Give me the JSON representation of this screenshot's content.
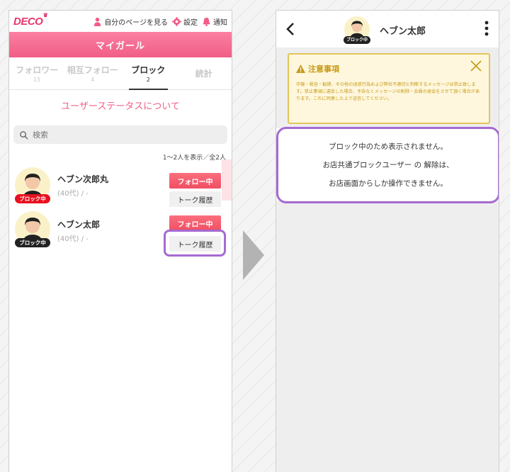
{
  "left": {
    "logo": "DECO",
    "header_links": [
      {
        "label": "自分のページを見る",
        "icon": "person-icon"
      },
      {
        "label": "設定",
        "icon": "gear-icon"
      },
      {
        "label": "通知",
        "icon": "bell-icon"
      }
    ],
    "title": "マイガール",
    "tabs": [
      {
        "label": "フォロワー",
        "count": "15"
      },
      {
        "label": "相互フォロー",
        "count": "4"
      },
      {
        "label": "ブロック",
        "count": "2"
      },
      {
        "label": "統計",
        "count": ""
      }
    ],
    "status_link": "ユーザーステータスについて",
    "search_placeholder": "検索",
    "count_text": "1〜2人を表示／全2人",
    "users": [
      {
        "name": "ヘブン次郎丸",
        "info": "(40代) / -",
        "badge": "ブロック中",
        "follow": "フォロー中",
        "talk": "トーク履歴"
      },
      {
        "name": "ヘブン太郎",
        "info": "(40代) / -",
        "badge": "ブロック中",
        "follow": "フォロー中",
        "talk": "トーク履歴"
      }
    ]
  },
  "right": {
    "user_name": "ヘブン太郎",
    "badge": "ブロック中",
    "notice_title": "注意事項",
    "notice_body": "中傷・脅迫・勧誘、その他の迷惑行為および弊社不適切と判断するメッセージは禁止致します。禁止事項に違反した場合、予告なくメッセージの削除・会員の退会をさせて頂く場合があります。これに同意した上で送信してください。",
    "block_lines": [
      "ブロック中のため表示されません。",
      "お店共通ブロックユーザー の 解除は、",
      "お店画面からしか操作できません。"
    ]
  },
  "colors": {
    "accent_pink": "#f15d86",
    "follow_red": "#f04f63",
    "highlight_purple": "#a66ad2",
    "notice_gold": "#c59a15"
  }
}
